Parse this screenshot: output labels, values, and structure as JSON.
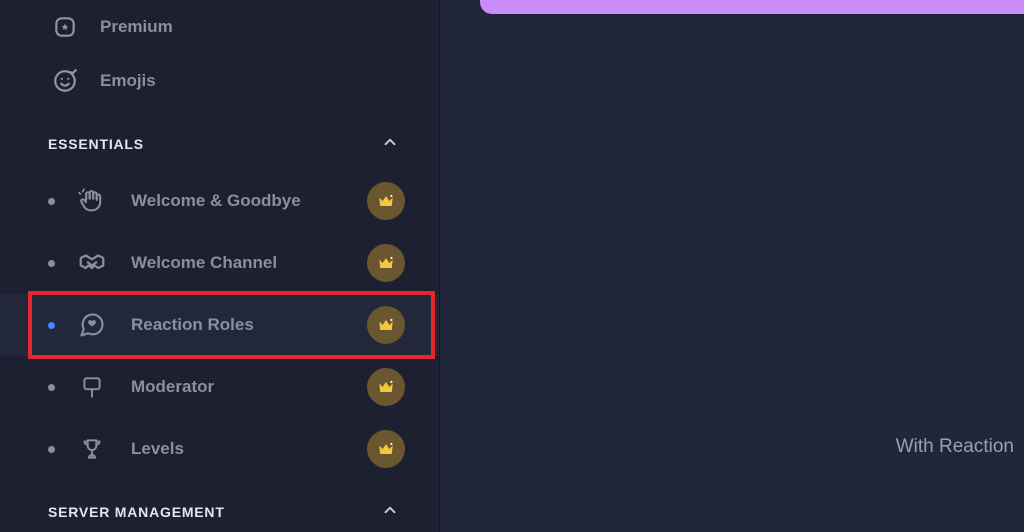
{
  "sidebar": {
    "top": [
      {
        "label": "Premium"
      },
      {
        "label": "Emojis"
      }
    ],
    "sections": [
      {
        "title": "ESSENTIALS",
        "items": [
          {
            "label": "Welcome & Goodbye"
          },
          {
            "label": "Welcome Channel"
          },
          {
            "label": "Reaction Roles"
          },
          {
            "label": "Moderator"
          },
          {
            "label": "Levels"
          }
        ]
      },
      {
        "title": "SERVER MANAGEMENT"
      }
    ]
  },
  "main": {
    "partial_text": "With Reaction"
  }
}
